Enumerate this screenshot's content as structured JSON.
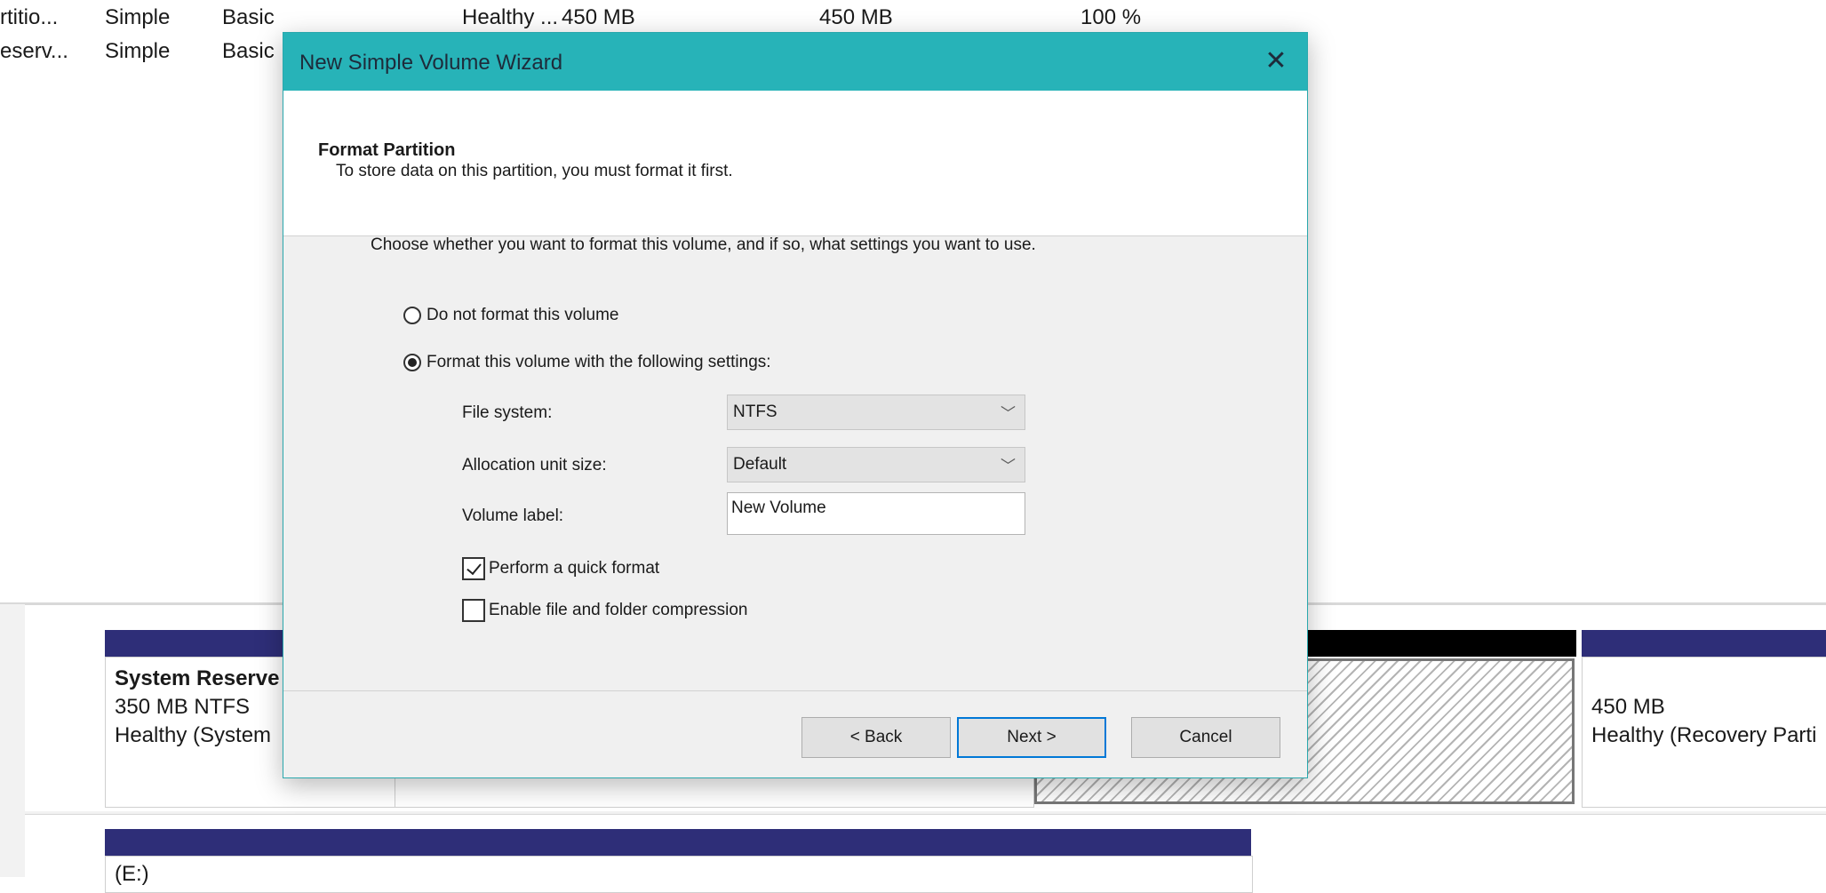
{
  "volume_list": {
    "rows": [
      {
        "volume": "rtitio...",
        "layout": "Simple",
        "type": "Basic",
        "status": "Healthy ...",
        "capacity": "450 MB",
        "free": "450 MB",
        "percent_free": "100 %"
      },
      {
        "volume": "eserv...",
        "layout": "Simple",
        "type": "Basic",
        "status": "",
        "capacity": "",
        "free": "",
        "percent_free": ""
      }
    ]
  },
  "disk_graph": {
    "disk0": {
      "system_reserved": {
        "name": "System Reserve",
        "size": "350 MB NTFS",
        "status": "Healthy (System"
      },
      "recovery": {
        "size": "450 MB",
        "status": "Healthy (Recovery Parti"
      }
    },
    "disk1": {
      "label": "(E:)"
    }
  },
  "dialog": {
    "title": "New Simple Volume Wizard",
    "close_glyph": "✕",
    "header_title": "Format Partition",
    "header_subtitle": "To store data on this partition, you must format it first.",
    "instructions": "Choose whether you want to format this volume, and if so, what settings you want to use.",
    "option_no_format": "Do not format this volume",
    "option_format": "Format this volume with the following settings:",
    "selected_option": "format",
    "file_system_label": "File system:",
    "file_system_value": "NTFS",
    "allocation_label": "Allocation unit size:",
    "allocation_value": "Default",
    "volume_label_label": "Volume label:",
    "volume_label_value": "New Volume",
    "quick_format_label": "Perform a quick format",
    "quick_format_checked": true,
    "compression_label": "Enable file and folder compression",
    "compression_checked": false,
    "chevron_glyph": "﹀",
    "back_label": "< Back",
    "next_label": "Next >",
    "cancel_label": "Cancel"
  },
  "colors": {
    "titlebar": "#27b3b8",
    "partition_bar": "#2e2e78",
    "unallocated_bar": "#000000",
    "focus_border": "#0078d7"
  }
}
